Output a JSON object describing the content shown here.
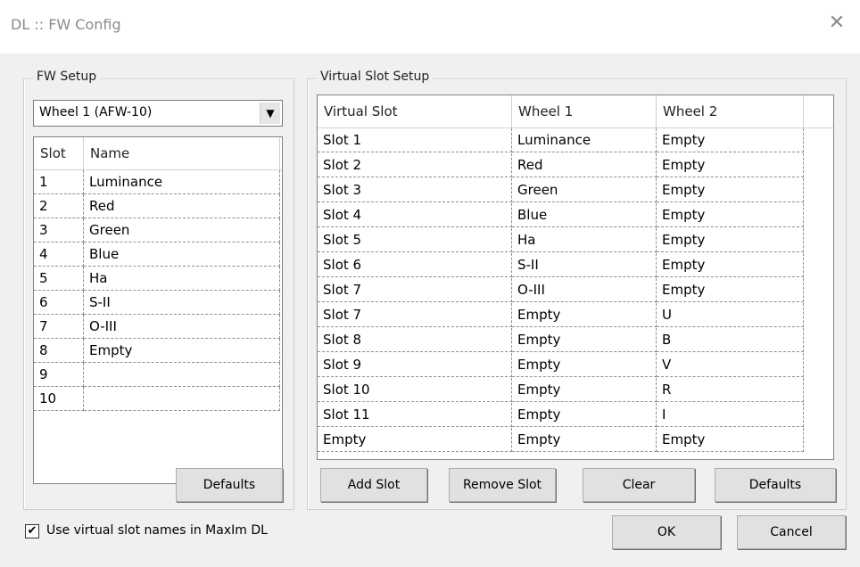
{
  "window": {
    "title": "DL :: FW Config",
    "close_icon": "close-icon"
  },
  "fw_setup": {
    "label": "FW Setup",
    "wheel_select": "Wheel 1 (AFW-10)",
    "columns": [
      "Slot",
      "Name"
    ],
    "rows": [
      [
        "1",
        "Luminance"
      ],
      [
        "2",
        "Red"
      ],
      [
        "3",
        "Green"
      ],
      [
        "4",
        "Blue"
      ],
      [
        "5",
        "Ha"
      ],
      [
        "6",
        "S-II"
      ],
      [
        "7",
        "O-III"
      ],
      [
        "8",
        "Empty"
      ],
      [
        "9",
        ""
      ],
      [
        "10",
        ""
      ]
    ],
    "defaults_label": "Defaults"
  },
  "virtual_slot_setup": {
    "label": "Virtual Slot Setup",
    "columns": [
      "Virtual Slot",
      "Wheel 1",
      "Wheel 2"
    ],
    "rows": [
      [
        "Slot 1",
        "Luminance",
        "Empty"
      ],
      [
        "Slot 2",
        "Red",
        "Empty"
      ],
      [
        "Slot 3",
        "Green",
        "Empty"
      ],
      [
        "Slot 4",
        "Blue",
        "Empty"
      ],
      [
        "Slot 5",
        "Ha",
        "Empty"
      ],
      [
        "Slot 6",
        "S-II",
        "Empty"
      ],
      [
        "Slot 7",
        "O-III",
        "Empty"
      ],
      [
        "Slot 7",
        "Empty",
        "U"
      ],
      [
        "Slot 8",
        "Empty",
        "B"
      ],
      [
        "Slot 9",
        "Empty",
        "V"
      ],
      [
        "Slot 10",
        "Empty",
        "R"
      ],
      [
        "Slot 11",
        "Empty",
        "I"
      ],
      [
        "Empty",
        "Empty",
        "Empty"
      ]
    ],
    "add_slot_label": "Add Slot",
    "remove_slot_label": "Remove Slot",
    "clear_label": "Clear",
    "defaults_label": "Defaults"
  },
  "footer": {
    "use_virtual_names_label": "Use virtual slot names in MaxIm DL",
    "use_virtual_names_checked": true,
    "ok_label": "OK",
    "cancel_label": "Cancel"
  }
}
